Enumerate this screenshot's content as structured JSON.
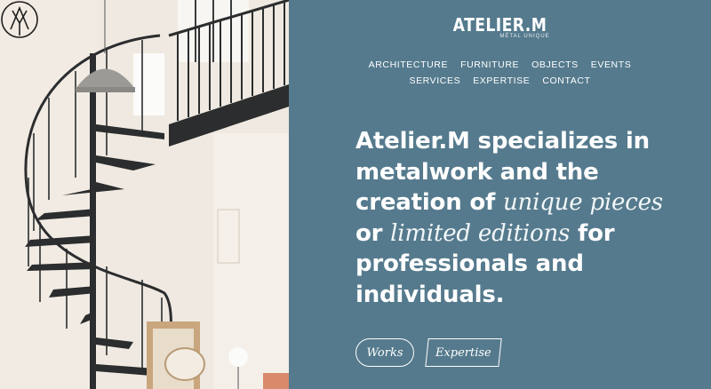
{
  "brand": {
    "name": "ATELIER.M",
    "tagline": "MÉTAL UNIQUE"
  },
  "nav": {
    "row1": [
      "ARCHITECTURE",
      "FURNITURE",
      "OBJECTS",
      "EVENTS"
    ],
    "row2": [
      "SERVICES",
      "EXPERTISE",
      "CONTACT"
    ]
  },
  "headline": {
    "part1": "Atelier.M specializes in metalwork and the creation of ",
    "em1": "unique pieces",
    "part2": " or ",
    "em2": "limited editions",
    "part3": " for professionals and individuals."
  },
  "buttons": {
    "works": "Works",
    "expertise": "Expertise"
  },
  "colors": {
    "panel": "#557a8d",
    "text": "#ffffff",
    "stair": "#2b2d2e",
    "wall": "#ece6dd"
  },
  "icons": {
    "logo": "am-monogram-icon"
  }
}
